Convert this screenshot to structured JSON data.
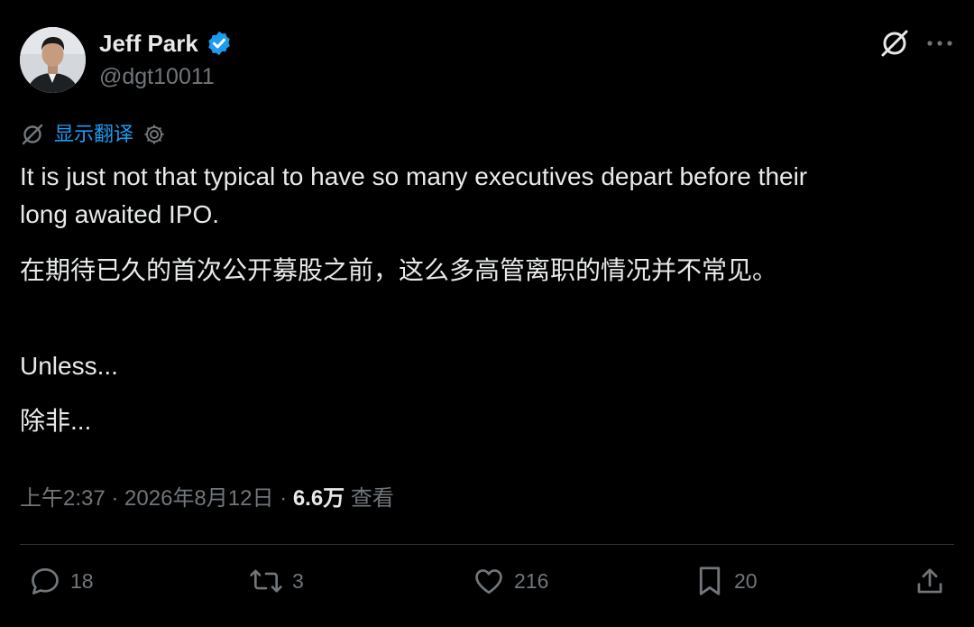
{
  "author": {
    "display_name": "Jeff Park",
    "handle": "@dgt10011",
    "verified": true,
    "verified_color": "#1d9bf0"
  },
  "translate": {
    "label": "显示翻译"
  },
  "tweet": {
    "line1": "It is just not that typical to have so many executives depart before their",
    "line2": "long awaited IPO.",
    "line3": "在期待已久的首次公开募股之前，这么多高管离职的情况并不常见。",
    "line4": "Unless...",
    "line5": "除非..."
  },
  "meta": {
    "time": "上午2:37",
    "sep1": " · ",
    "date": "2026年8月12日",
    "sep2": " · ",
    "views_count": "6.6万",
    "views_label": " 查看"
  },
  "actions": {
    "replies": "18",
    "retweets": "3",
    "likes": "216",
    "bookmarks": "20"
  },
  "colors": {
    "background": "#000000",
    "text": "#e7e9ea",
    "muted": "#71767b",
    "accent": "#1d9bf0",
    "divider": "#2f3336"
  },
  "icons": [
    "grok-icon",
    "more-icon",
    "translate-icon",
    "gear-icon",
    "reply-icon",
    "retweet-icon",
    "like-icon",
    "bookmark-icon",
    "share-icon"
  ]
}
